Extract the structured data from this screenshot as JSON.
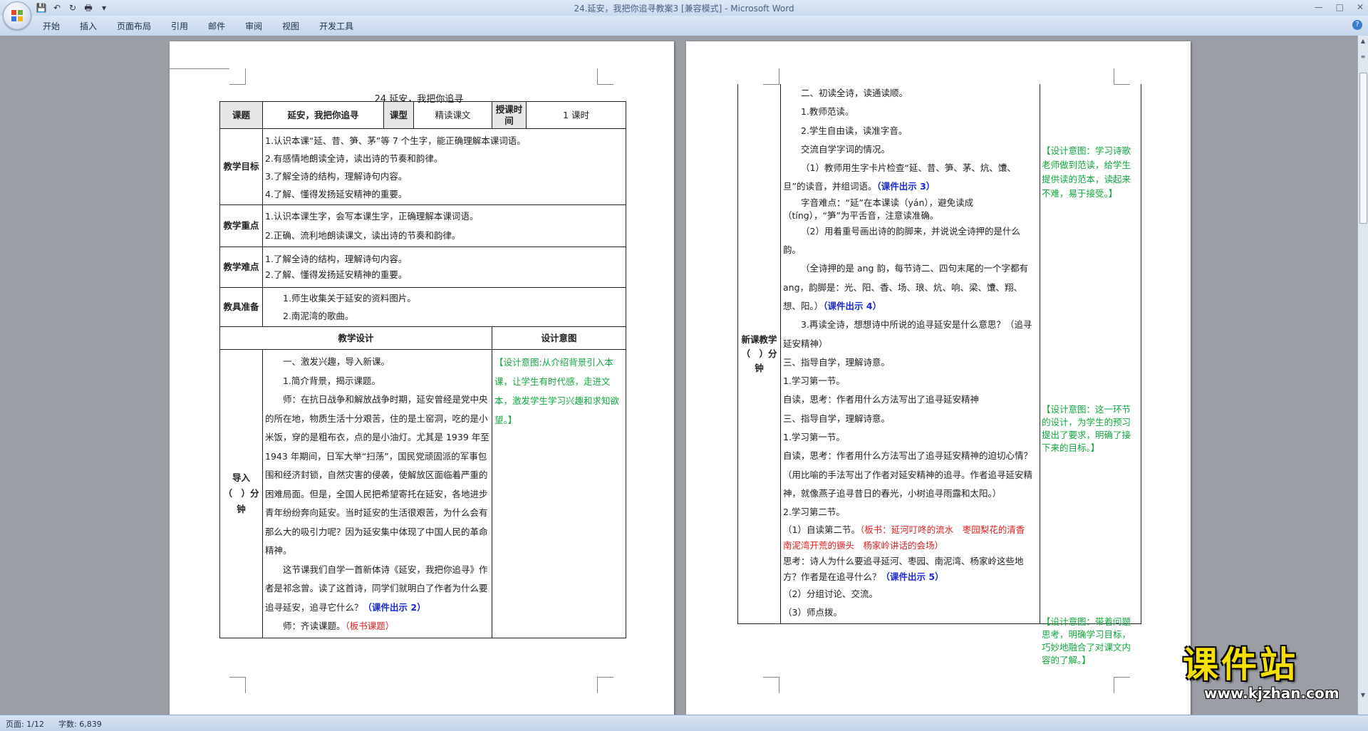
{
  "window": {
    "title": "24.延安，我把你追寻教案3 [兼容模式] - Microsoft Word",
    "minimize": "—",
    "maximize": "□",
    "close": "✕"
  },
  "ribbon": {
    "tabs": [
      "开始",
      "插入",
      "页面布局",
      "引用",
      "邮件",
      "审阅",
      "视图",
      "开发工具"
    ]
  },
  "status": {
    "page": "页面: 1/12",
    "words": "字数: 6,839"
  },
  "page1": {
    "title": "24 延安，我把你追寻",
    "row1": {
      "k1": "课题",
      "v1": "延安，我把你追寻",
      "k2": "课型",
      "v2": "精读课文",
      "k3": "授课时间",
      "v3": "1 课时"
    },
    "goals": {
      "label": "教学目标",
      "items": [
        "1.认识本课“延、昔、笋、茅”等 7 个生字，能正确理解本课词语。",
        "2.有感情地朗读全诗，读出诗的节奏和韵律。",
        "3.了解全诗的结构，理解诗句内容。",
        "4.了解、懂得发扬延安精神的重要。"
      ]
    },
    "key": {
      "label": "教学重点",
      "items": [
        "1.认识本课生字，会写本课生字，正确理解本课词语。",
        "2.正确、流利地朗读课文，读出诗的节奏和韵律。"
      ]
    },
    "hard": {
      "label": "教学难点",
      "items": [
        "1.了解全诗的结构，理解诗句内容。",
        "2.了解、懂得发扬延安精神的重要。"
      ]
    },
    "prep": {
      "label": "教具准备",
      "items": [
        "1.师生收集关于延安的资料图片。",
        "2.南泥湾的歌曲。"
      ]
    },
    "design_header": "教学设计",
    "intent_header": "设计意图",
    "intro_label": "导入（　）分钟",
    "intro": {
      "l1": "一、激发兴趣，导入新课。",
      "l2": "1.简介背景，揭示课题。",
      "l3": "师：在抗日战争和解放战争时期，延安曾经是党中央的所在地，物质生活十分艰苦，住的是土窑洞，吃的是小米饭，穿的是粗布衣，点的是小油灯。尤其是 1939 年至 1943 年期间，日军大举“扫荡”，国民党顽固派的军事包围和经济封锁，自然灾害的侵袭，使解放区面临着严重的困难局面。但是，全国人民把希望寄托在延安，各地进步青年纷纷奔向延安。当时延安的生活很艰苦，为什么会有那么大的吸引力呢？因为延安集中体现了中国人民的革命精神。",
      "l4": "这节课我们自学一首新体诗《延安，我把你追寻》作者是祁念曾。读了这首诗，同学们就明白了作者为什么要追寻延安，追寻它什么？",
      "l4b": "（课件出示 2）",
      "l5": "师：齐读课题。",
      "l5b": "（板书课题）",
      "intent": "【设计意图:从介绍背景引入本课，让学生有时代感，走进文本，激发学生学习兴趣和求知欲望。】"
    }
  },
  "page2": {
    "label": "新课教学（　）分钟",
    "p1": "二、初读全诗，读通读顺。",
    "p2": "1.教师范读。",
    "p3": "2.学生自由读，读准字音。",
    "p4": "交流自学字词的情况。",
    "p5": "（1）教师用生字卡片检查“延、昔、笋、茅、炕、馕、旦”的读音，并组词语。",
    "p5b": "（课件出示 3）",
    "p6": "字音难点：“延”在本课读（yán），避免读成（tíng），“笋”为平舌音，注意读准确。",
    "p7": "（2）用着重号画出诗的韵脚来，并说说全诗押的是什么韵。",
    "p8": "（全诗押的是 ang 韵，每节诗二、四句末尾的一个字都有 ang，韵脚是：光、阳、香、场、琅、炕、响、梁、馕、翔、想、阳。）",
    "p8b": "（课件出示 4）",
    "p9": "3.再读全诗，想想诗中所说的追寻延安是什么意思？（追寻延安精神）",
    "p10": "三、指导自学，理解诗意。",
    "p11": "1.学习第一节。",
    "p12": "自读，思考：作者用什么方法写出了追寻延安精神",
    "p13": "三、指导自学，理解诗意。",
    "p14": "1.学习第一节。",
    "p15": "自读，思考：作者用什么方法写出了追寻延安精神的迫切心情？",
    "p16": "（用比喻的手法写出了作者对延安精神的追寻。作者追寻延安精神，就像燕子追寻昔日的春光，小树追寻雨露和太阳。）",
    "p17": "2.学习第二节。",
    "p18": "（1）自读第二节。",
    "p18b": "（板书：延河叮咚的流水　枣园梨花的清香　南泥湾开荒的镢头　杨家岭讲话的会场）",
    "p19": "思考：诗人为什么要追寻延河、枣园、南泥湾、杨家岭这些地方？作者是在追寻什么？",
    "p19b": "（课件出示 5）",
    "p20": "（2）分组讨论、交流。",
    "p21": "（3）师点拨。",
    "intent1": "【设计意图：学习诗歌老师做到范读，给学生提供读的范本，读起来不难，易于接受。】",
    "intent2": "【设计意图：这一环节的设计，为学生的预习提出了要求，明确了接下来的目标。】",
    "intent3": "【设计意图：带着问题思考，明确学习目标，巧妙地融合了对课文内容的了解。】"
  },
  "watermark": {
    "big": "课件站",
    "small": "www.kjzhan.com"
  },
  "colors": {
    "intent": "#11a83e",
    "courseware": "#1a2bd6",
    "board": "#e02020"
  }
}
